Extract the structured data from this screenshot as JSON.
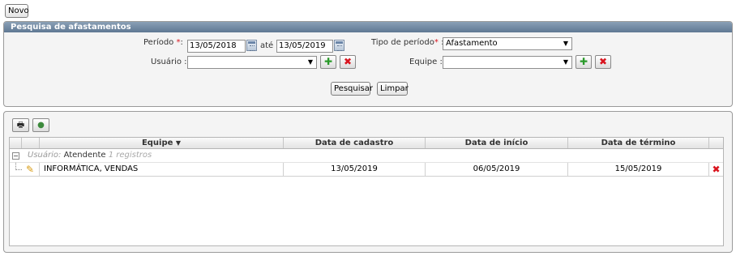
{
  "toolbar": {
    "new_label": "Novo"
  },
  "search_panel": {
    "title": "Pesquisa de afastamentos",
    "periodo_label": "Período",
    "required_mark": "*",
    "label_suffix": ":",
    "periodo_start": "13/05/2018",
    "ate_label": "até",
    "periodo_end": "13/05/2019",
    "tipo_periodo_label": "Tipo de período",
    "tipo_periodo_value": "Afastamento",
    "usuario_label": "Usuário :",
    "usuario_value": "",
    "equipe_label": "Equipe :",
    "equipe_value": "",
    "search_label": "Pesquisar",
    "clear_label": "Limpar"
  },
  "grid": {
    "columns": [
      "Equipe",
      "Data de cadastro",
      "Data de início",
      "Data de término"
    ],
    "sort_indicator": "▼",
    "group": {
      "label": "Usuário:",
      "value": "Atendente",
      "count": "1 registros"
    },
    "rows": [
      {
        "equipe": "INFORMÁTICA, VENDAS",
        "cadastro": "13/05/2019",
        "inicio": "06/05/2019",
        "termino": "15/05/2019"
      }
    ]
  },
  "icons": {
    "add": "add-icon",
    "remove": "remove-icon",
    "calendar": "calendar-icon",
    "edit": "pencil-icon"
  }
}
